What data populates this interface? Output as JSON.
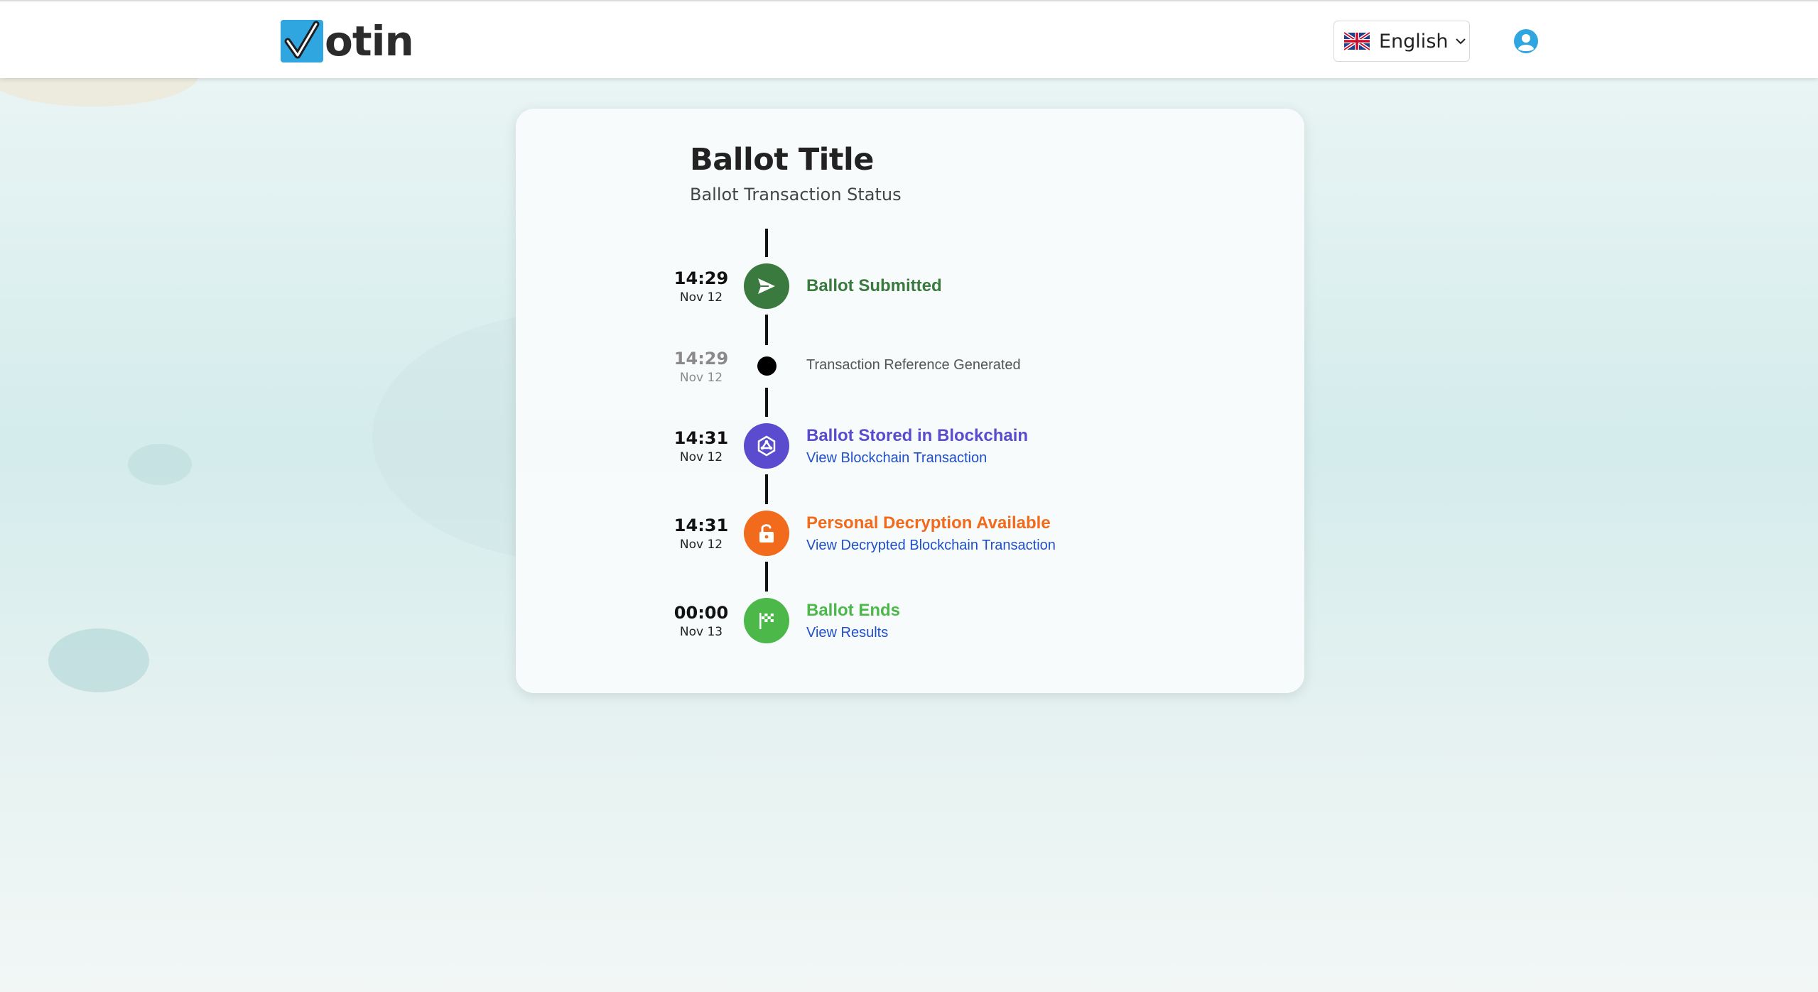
{
  "header": {
    "logo_text": "otin",
    "language": "English",
    "flag_icon": "uk-flag-icon",
    "user_icon": "user-circle-icon"
  },
  "ballot": {
    "title": "Ballot Title",
    "subtitle": "Ballot Transaction Status"
  },
  "timeline": [
    {
      "time": "14:29",
      "date": "Nov 12",
      "label": "Ballot Submitted",
      "icon": "send-icon",
      "color": "#3a7a3e"
    },
    {
      "time": "14:29",
      "date": "Nov 12",
      "label": "Transaction Reference Generated",
      "icon": "dot-icon",
      "color": "#000000"
    },
    {
      "time": "14:31",
      "date": "Nov 12",
      "label": "Ballot Stored in Blockchain",
      "link": "View Blockchain Transaction",
      "icon": "blockchain-icon",
      "color": "#5b4ccf"
    },
    {
      "time": "14:31",
      "date": "Nov 12",
      "label": "Personal Decryption Available",
      "link": "View Decrypted Blockchain Transaction",
      "icon": "unlock-icon",
      "color": "#f26a1b"
    },
    {
      "time": "00:00",
      "date": "Nov 13",
      "label": "Ballot Ends",
      "link": "View Results",
      "icon": "checkered-flag-icon",
      "color": "#4cb84a"
    }
  ],
  "colors": {
    "brand_blue": "#2fa6e0",
    "link": "#1f4fc9"
  }
}
